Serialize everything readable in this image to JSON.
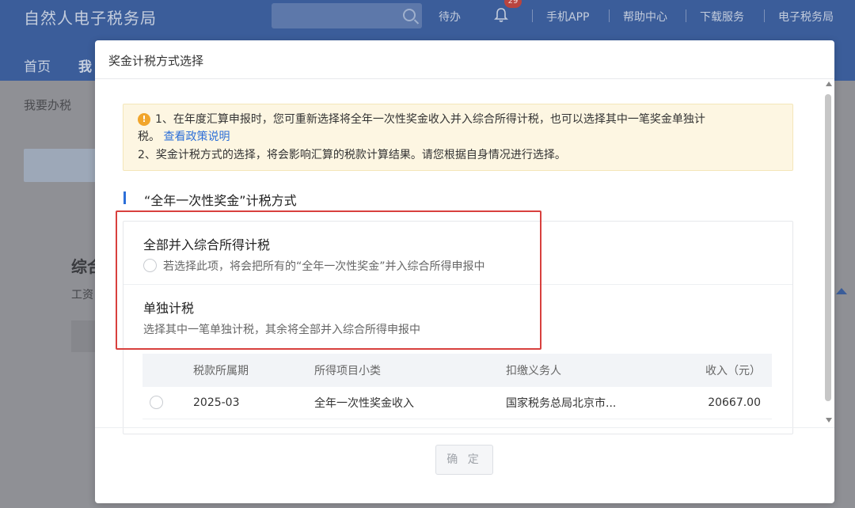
{
  "background": {
    "app_title": "自然人电子税务局",
    "search": {
      "placeholder": ""
    },
    "top_links": [
      "待办",
      "手机APP",
      "帮助中心",
      "下载服务",
      "电子税务局"
    ],
    "notification_count": "29",
    "nav": [
      "首页",
      "我"
    ],
    "breadcrumb": "我要办税",
    "section_heading": "综合",
    "section_sub": "工资",
    "brand_color": "#3b5d9a"
  },
  "modal": {
    "title": "奖金计税方式选择",
    "notice": {
      "line1": "1、在年度汇算申报时，您可重新选择将全年一次性奖金收入并入综合所得计税，也可以选择其中一笔奖金单独计",
      "line2_prefix": "税。",
      "policy_link": "查看政策说明",
      "line3": "2、奖金计税方式的选择，将会影响汇算的税款计算结果。请您根据自身情况进行选择。"
    },
    "section_title": "“全年一次性奖金”计税方式",
    "options": [
      {
        "title": "全部并入综合所得计税",
        "desc": "若选择此项，将会把所有的“全年一次性奖金”并入综合所得申报中",
        "selected": false
      },
      {
        "title": "单独计税",
        "desc": "选择其中一笔单独计税，其余将全部并入综合所得申报中",
        "selected": true
      }
    ],
    "table": {
      "headers": [
        "",
        "税款所属期",
        "所得项目小类",
        "扣缴义务人",
        "收入（元）"
      ],
      "rows": [
        {
          "period": "2025-03",
          "item": "全年一次性奖金收入",
          "agent": "国家税务总局北京市...",
          "income": "20667.00"
        }
      ]
    },
    "confirm_label": "确 定",
    "highlight_color": "#d8403e",
    "link_color": "#2c6fd8"
  }
}
